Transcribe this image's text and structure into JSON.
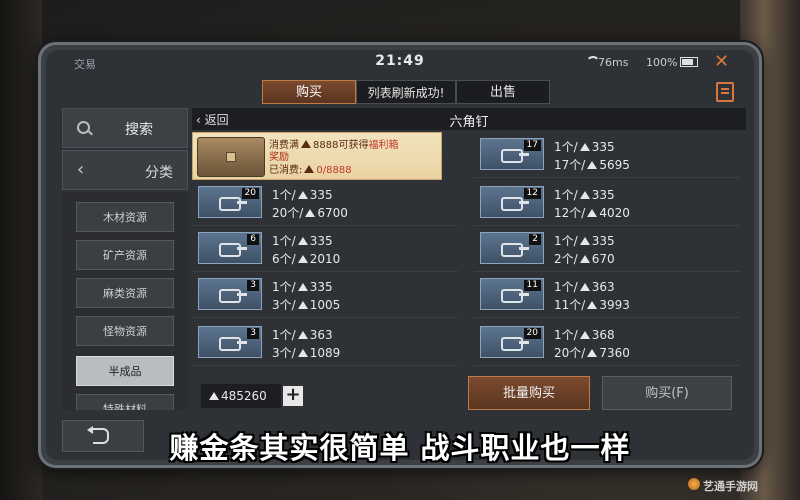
{
  "status": {
    "app_name": "交易",
    "time": "21:49",
    "network": "76ms",
    "battery": "100%"
  },
  "tabs": {
    "buy": "购买",
    "toast": "列表刷新成功!",
    "sell": "出售"
  },
  "sidebar": {
    "search_label": "搜索",
    "category_label": "分类",
    "items": [
      {
        "label": "木材资源"
      },
      {
        "label": "矿产资源"
      },
      {
        "label": "麻类资源"
      },
      {
        "label": "怪物资源"
      },
      {
        "label": "半成品",
        "selected": true
      },
      {
        "label": "特殊材料"
      }
    ]
  },
  "listing": {
    "back_label": "返回",
    "title": "六角钉",
    "promo": {
      "line1_prefix": "消费满",
      "line1_amount": "8888可获得",
      "line1_reward": "福利箱",
      "line2": "奖励",
      "line3_prefix": "已消费:",
      "line3_value": "0/8888"
    },
    "cards": [
      {
        "qty": "17",
        "unit": "1个/",
        "unit_price": "335",
        "total_prefix": "17个/",
        "total": "5695"
      },
      {
        "qty": "20",
        "unit": "1个/",
        "unit_price": "335",
        "total_prefix": "20个/",
        "total": "6700"
      },
      {
        "qty": "12",
        "unit": "1个/",
        "unit_price": "335",
        "total_prefix": "12个/",
        "total": "4020"
      },
      {
        "qty": "6",
        "unit": "1个/",
        "unit_price": "335",
        "total_prefix": "6个/",
        "total": "2010"
      },
      {
        "qty": "2",
        "unit": "1个/",
        "unit_price": "335",
        "total_prefix": "2个/",
        "total": "670"
      },
      {
        "qty": "3",
        "unit": "1个/",
        "unit_price": "335",
        "total_prefix": "3个/",
        "total": "1005"
      },
      {
        "qty": "11",
        "unit": "1个/",
        "unit_price": "363",
        "total_prefix": "11个/",
        "total": "3993"
      },
      {
        "qty": "3",
        "unit": "1个/",
        "unit_price": "363",
        "total_prefix": "3个/",
        "total": "1089"
      },
      {
        "qty": "20",
        "unit": "1个/",
        "unit_price": "368",
        "total_prefix": "20个/",
        "total": "7360"
      }
    ]
  },
  "bottom": {
    "balance": "485260",
    "plus": "+",
    "bulk_buy": "批量购买",
    "buy": "购买(F)"
  },
  "caption": "赚金条其实很简单 战斗职业也一样",
  "watermark": "艺通手游网"
}
